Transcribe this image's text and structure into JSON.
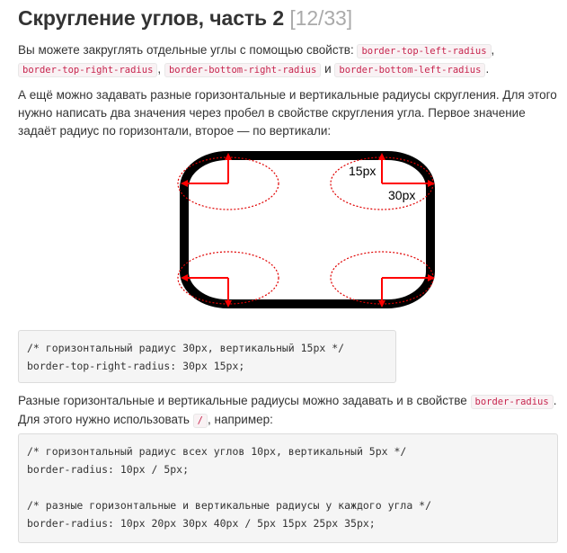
{
  "header": {
    "title": "Скругление углов, часть 2",
    "counter": "[12/33]"
  },
  "intro": {
    "text_before": "Вы можете закруглять отдельные углы с помощью свойств: ",
    "prop_tl": "border-top-left-radius",
    "sep1": ",",
    "prop_tr": "border-top-right-radius",
    "sep2": ",",
    "prop_br": "border-bottom-right-radius",
    "conj": "и",
    "prop_bl": "border-bottom-left-radius",
    "end": "."
  },
  "explain": {
    "text": "А ещё можно задавать разные горизонтальные и вертикальные радиусы скругления. Для этого нужно написать два значения через пробел в свойстве скругления угла. Первое значение задаёт радиус по горизонтали, второе — по вертикали:"
  },
  "figure": {
    "label_vertical": "15px",
    "label_horizontal": "30px",
    "colors": {
      "border": "#000000",
      "arrow": "#ff0000",
      "ellipse": "#e00000"
    }
  },
  "code_block_1": {
    "lines": [
      "/* горизонтальный радиус 30px, вертикальный 15px */",
      "border-top-right-radius: 30px 15px;"
    ]
  },
  "shorthand": {
    "text_before": "Разные горизонтальные и вертикальные радиусы можно задавать и в свойстве ",
    "prop": "border-radius",
    "end": ".",
    "text_line2_before": "Для этого нужно использовать ",
    "slash": "/",
    "text_line2_after": ", например:"
  },
  "code_block_2": {
    "lines": [
      "/* горизонтальный радиус всех углов 10px, вертикальный 5px */",
      "border-radius: 10px / 5px;",
      "",
      "/* разные горизонтальные и вертикальные радиусы у каждого угла */",
      "border-radius: 10px 20px 30px 40px / 5px 15px 25px 35px;"
    ]
  }
}
